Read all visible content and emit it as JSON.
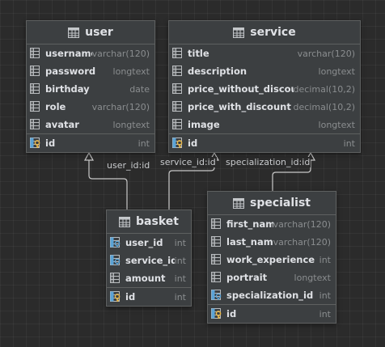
{
  "entities": {
    "user": {
      "name": "user",
      "columns": [
        {
          "name": "username",
          "type": "varchar(120)",
          "key": "none"
        },
        {
          "name": "password",
          "type": "longtext",
          "key": "none"
        },
        {
          "name": "birthday",
          "type": "date",
          "key": "none"
        },
        {
          "name": "role",
          "type": "varchar(120)",
          "key": "none"
        },
        {
          "name": "avatar",
          "type": "longtext",
          "key": "none"
        }
      ],
      "pk": {
        "name": "id",
        "type": "int",
        "key": "pk"
      }
    },
    "service": {
      "name": "service",
      "columns": [
        {
          "name": "title",
          "type": "varchar(120)",
          "key": "none"
        },
        {
          "name": "description",
          "type": "longtext",
          "key": "none"
        },
        {
          "name": "price_without_discount",
          "type": "decimal(10,2)",
          "key": "none"
        },
        {
          "name": "price_with_discount",
          "type": "decimal(10,2)",
          "key": "none"
        },
        {
          "name": "image",
          "type": "longtext",
          "key": "none"
        }
      ],
      "pk": {
        "name": "id",
        "type": "int",
        "key": "pk"
      }
    },
    "basket": {
      "name": "basket",
      "columns": [
        {
          "name": "user_id",
          "type": "int",
          "key": "fk"
        },
        {
          "name": "service_id",
          "type": "int",
          "key": "fk"
        },
        {
          "name": "amount",
          "type": "int",
          "key": "none"
        }
      ],
      "pk": {
        "name": "id",
        "type": "int",
        "key": "pk"
      }
    },
    "specialist": {
      "name": "specialist",
      "columns": [
        {
          "name": "first_name",
          "type": "varchar(120)",
          "key": "none"
        },
        {
          "name": "last_name",
          "type": "varchar(120)",
          "key": "none"
        },
        {
          "name": "work_experience",
          "type": "int",
          "key": "none"
        },
        {
          "name": "portrait",
          "type": "longtext",
          "key": "none"
        },
        {
          "name": "specialization_id",
          "type": "int",
          "key": "fk"
        }
      ],
      "pk": {
        "name": "id",
        "type": "int",
        "key": "pk"
      }
    }
  },
  "relations": [
    {
      "label": "user_id:id",
      "from": "basket",
      "to": "user"
    },
    {
      "label": "service_id:id",
      "from": "basket",
      "to": "service"
    },
    {
      "label": "specialization_id:id",
      "from": "specialist",
      "to": "service"
    }
  ],
  "icons": {
    "entity": "table-icon",
    "column": "column-icon",
    "foreign_key": "foreign-key-icon",
    "primary_key": "primary-key-icon"
  },
  "colors": {
    "background": "#2b2b2b",
    "entity_bg": "#3c3f41",
    "text": "#dfe1e5",
    "type_text": "#8a8d8f",
    "edge": "#c8c8c8",
    "key_gold": "#e8b84a",
    "fk_blue": "#5aa3d6"
  }
}
